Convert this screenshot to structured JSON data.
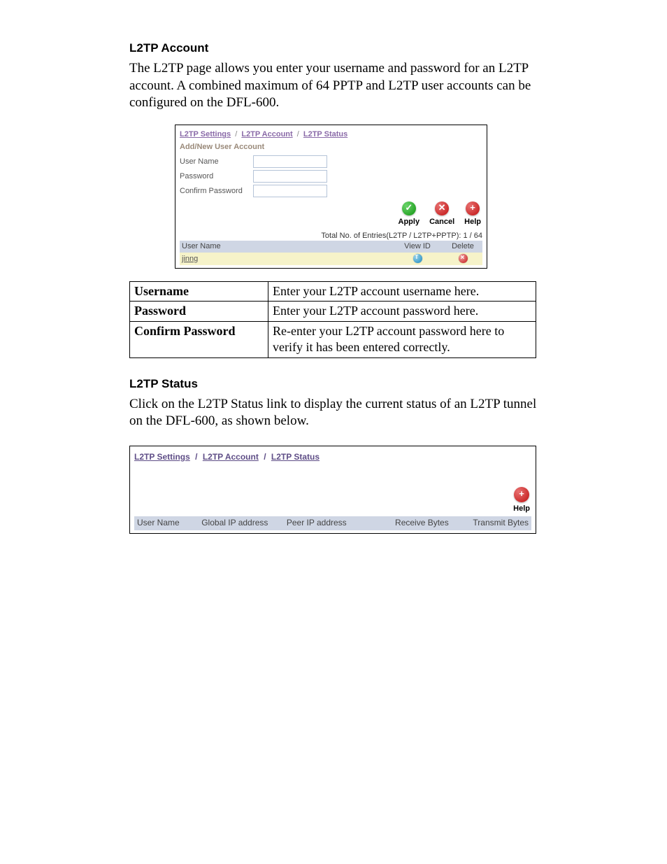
{
  "section1": {
    "heading": "L2TP Account",
    "body": "The L2TP page allows you enter your username and password for an L2TP account.  A combined maximum of 64 PPTP and L2TP user accounts can be configured on the DFL-600."
  },
  "shot1": {
    "tabs": [
      "L2TP Settings",
      "L2TP Account",
      "L2TP Status"
    ],
    "subtitle": "Add/New User Account",
    "labels": {
      "username": "User Name",
      "password": "Password",
      "confirm": "Confirm Password"
    },
    "buttons": {
      "apply": "Apply",
      "cancel": "Cancel",
      "help": "Help"
    },
    "entries_line": "Total No. of Entries(L2TP / L2TP+PPTP): 1 / 64",
    "acct_table": {
      "cols": [
        "User Name",
        "View ID",
        "Delete"
      ],
      "row_user": "jinng"
    }
  },
  "def_table": [
    {
      "k": "Username",
      "v": "Enter your L2TP account username here."
    },
    {
      "k": "Password",
      "v": "Enter your L2TP account password here."
    },
    {
      "k": "Confirm Password",
      "v": "Re-enter your L2TP account password here to verify it has been entered correctly."
    }
  ],
  "section2": {
    "heading": "L2TP Status",
    "body": "Click on the L2TP Status link to display the current status of an L2TP tunnel on the DFL-600, as shown below."
  },
  "shot2": {
    "tabs": [
      "L2TP Settings",
      "L2TP Account",
      "L2TP Status"
    ],
    "help": "Help",
    "cols": [
      "User Name",
      "Global IP address",
      "Peer IP address",
      "Receive Bytes",
      "Transmit Bytes"
    ]
  }
}
